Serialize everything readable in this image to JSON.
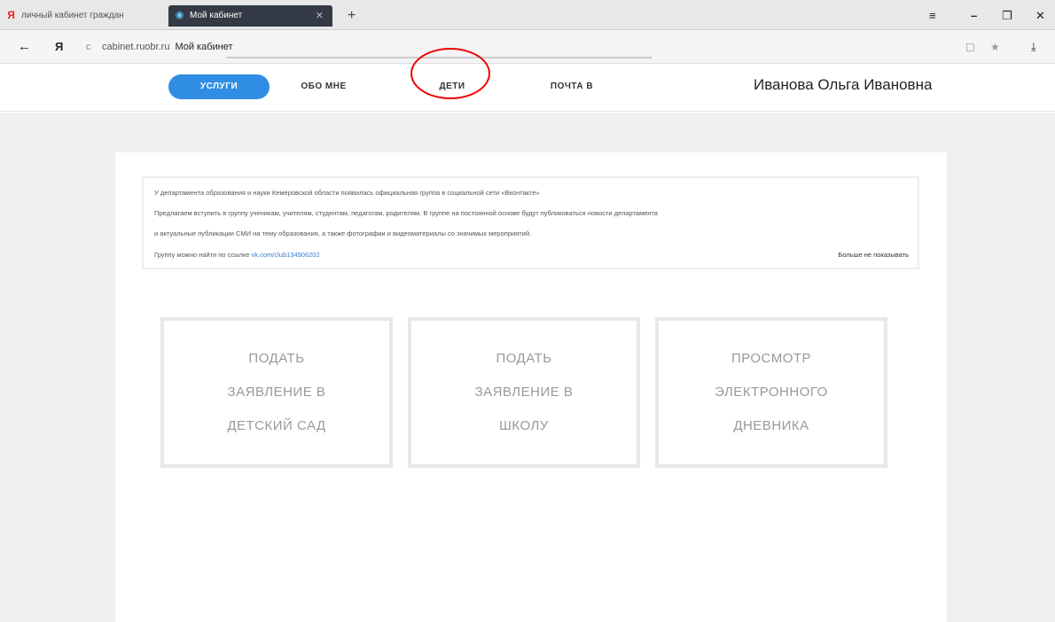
{
  "browser": {
    "tabs": [
      {
        "label": "личный кабинет граждан",
        "icon": "yandex-icon"
      },
      {
        "label": "Мой кабинет",
        "icon": "site-icon"
      }
    ],
    "new_tab": "+",
    "window_controls": [
      "≡",
      "–",
      "❐",
      "✕"
    ],
    "address": {
      "url": "cabinet.ruobr.ru",
      "page_title": "Мой кабинет"
    },
    "nav_back": "←",
    "nav_home": "Я",
    "refresh": "c",
    "toolbar_icons": [
      "□",
      "★",
      "⤓"
    ]
  },
  "header": {
    "nav": [
      {
        "label": "УСЛУГИ",
        "active": true
      },
      {
        "label": "ОБО МНЕ",
        "active": false
      },
      {
        "label": "ДЕТИ",
        "active": false
      },
      {
        "label": "ПОЧТА В",
        "active": false
      }
    ],
    "user_name": "Иванова Ольга Ивановна"
  },
  "notice": {
    "line1": "У департамента образования и науки Кемеровской области появилась официальная группа в социальной сети «Вконтакте»",
    "line2": "Предлагаем вступить в группу ученикам, учителям, студентам, педагогам, родителям. В группе на постоянной основе будут публиковаться новости департамента",
    "line3": "и актуальные публикации СМИ на тему образования, а также фотографии и видеоматериалы со значимых мероприятий.",
    "line4_prefix": "Группу можно найти по ссылке",
    "link": "vk.com/club134906202",
    "dismiss": "Больше не показывать"
  },
  "cards": [
    {
      "lines": [
        "ПОДАТЬ",
        "ЗАЯВЛЕНИЕ В",
        "ДЕТСКИЙ САД"
      ]
    },
    {
      "lines": [
        "ПОДАТЬ",
        "ЗАЯВЛЕНИЕ В",
        "ШКОЛУ"
      ]
    },
    {
      "lines": [
        "ПРОСМОТР",
        "ЭЛЕКТРОННОГО",
        "ДНЕВНИКА"
      ]
    }
  ],
  "colors": {
    "accent": "#2f8de4",
    "highlight_circle": "#e00000",
    "link": "#3a7bd5"
  }
}
